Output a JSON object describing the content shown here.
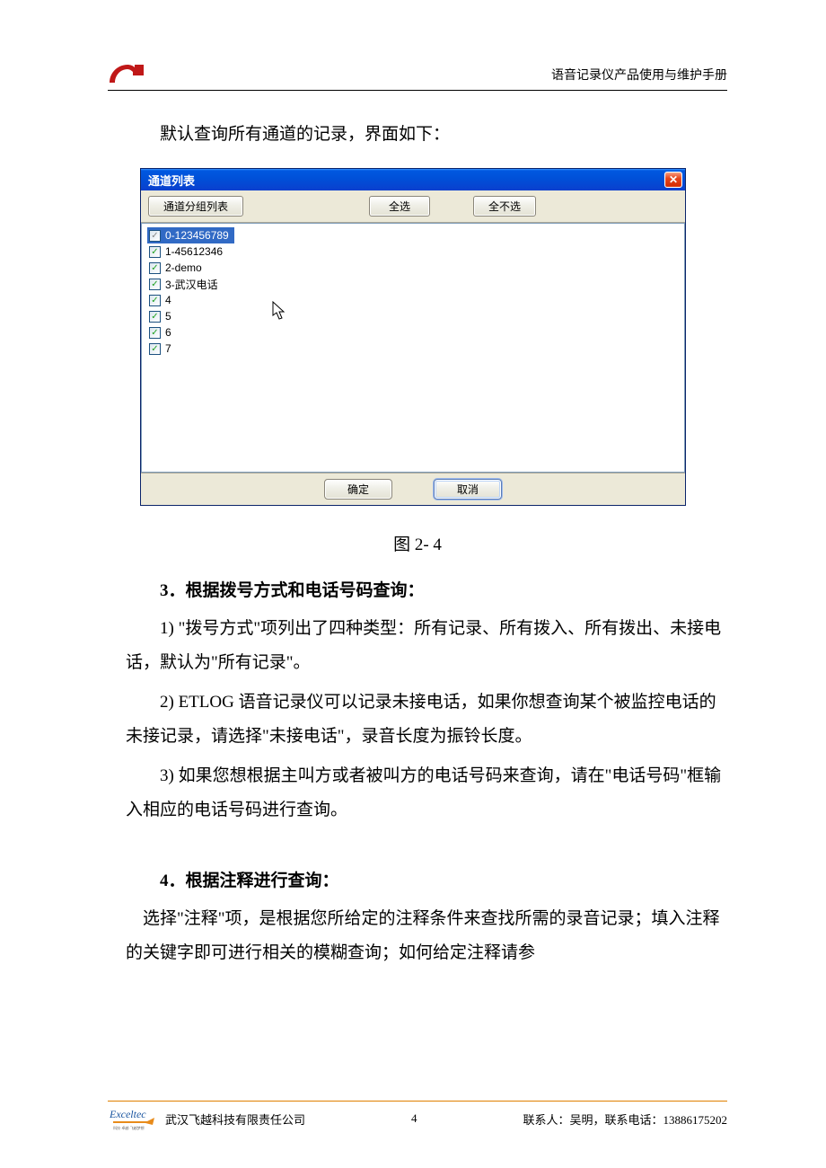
{
  "header": {
    "doc_title": "语音记录仪产品使用与维护手册"
  },
  "intro": "默认查询所有通道的记录，界面如下：",
  "dialog": {
    "title": "通道列表",
    "close_symbol": "✕",
    "toolbar": {
      "group_list": "通道分组列表",
      "select_all": "全选",
      "select_none": "全不选"
    },
    "items": [
      {
        "label": "0-123456789",
        "selected": true
      },
      {
        "label": "1-45612346",
        "selected": false
      },
      {
        "label": "2-demo",
        "selected": false
      },
      {
        "label": "3-武汉电话",
        "selected": false
      },
      {
        "label": "4",
        "selected": false
      },
      {
        "label": "5",
        "selected": false
      },
      {
        "label": "6",
        "selected": false
      },
      {
        "label": "7",
        "selected": false
      }
    ],
    "ok": "确定",
    "cancel": "取消"
  },
  "caption": "图 2- 4",
  "section3": {
    "heading": "3．根据拨号方式和电话号码查询：",
    "p1": "1)  \"拨号方式\"项列出了四种类型：所有记录、所有拨入、所有拨出、未接电话，默认为\"所有记录\"。",
    "p2": "2)  ETLOG 语音记录仪可以记录未接电话，如果你想查询某个被监控电话的未接记录，请选择\"未接电话\"，录音长度为振铃长度。",
    "p3": "3)  如果您想根据主叫方或者被叫方的电话号码来查询，请在\"电话号码\"框输入相应的电话号码进行查询。"
  },
  "section4": {
    "heading": "4．根据注释进行查询：",
    "p1": "选择\"注释\"项，是根据您所给定的注释条件来查找所需的录音记录；填入注释的关键字即可进行相关的模糊查询；如何给定注释请参"
  },
  "footer": {
    "logo_text": "Exceltec",
    "company": "武汉飞越科技有限责任公司",
    "page": "4",
    "contact": "联系人：吴明，联系电话：13886175202"
  }
}
